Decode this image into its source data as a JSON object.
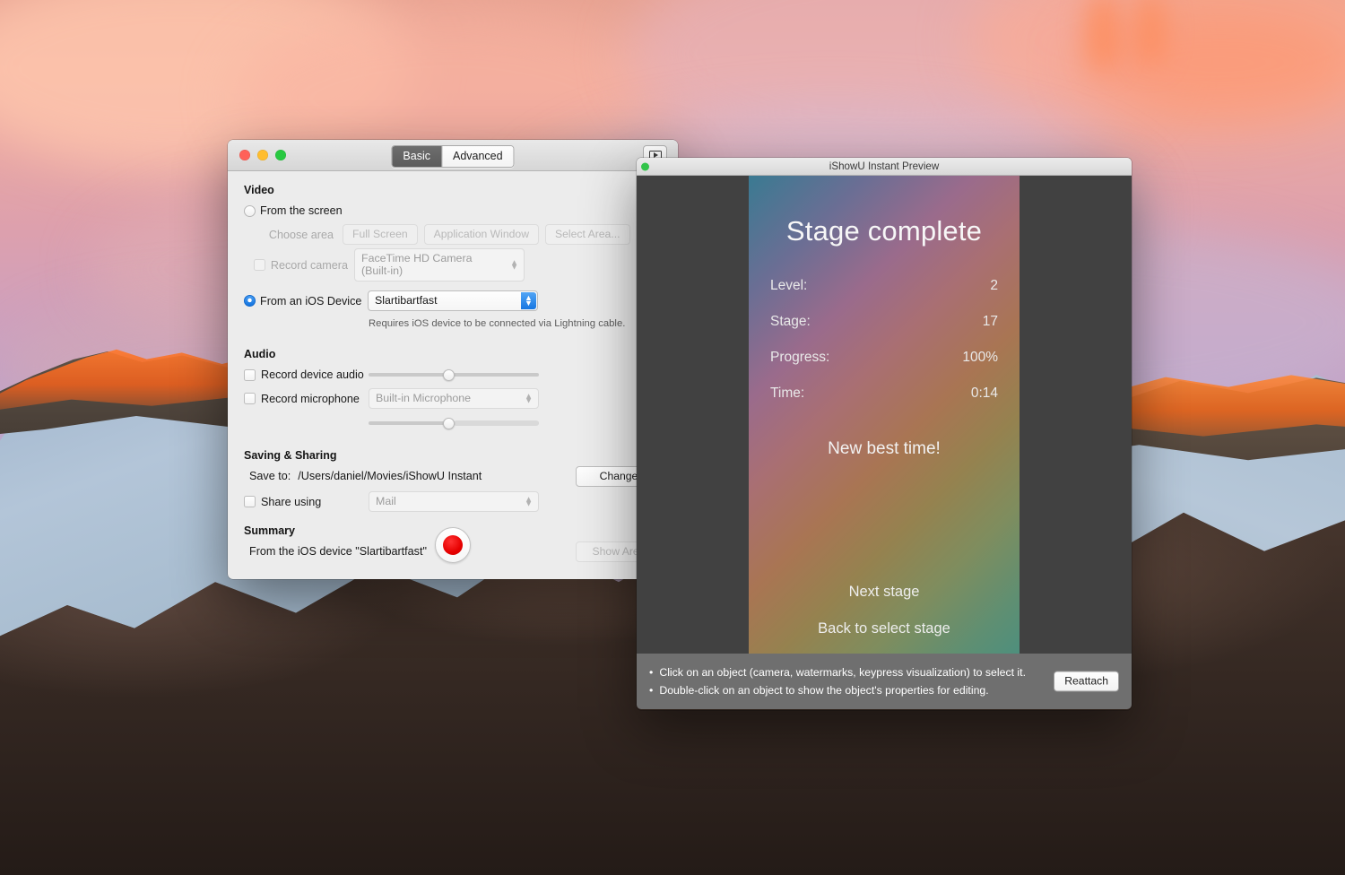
{
  "settings_window": {
    "traffic_lights": {
      "close": "close-button",
      "minimize": "minimize-button",
      "zoom": "zoom-button"
    },
    "tabs": [
      {
        "label": "Basic",
        "active": true
      },
      {
        "label": "Advanced",
        "active": false
      }
    ],
    "preview_toggle_icon": "preview-play-icon",
    "video": {
      "heading": "Video",
      "from_screen_label": "From the screen",
      "from_screen_selected": false,
      "choose_area_label": "Choose area",
      "area_buttons": [
        "Full Screen",
        "Application Window",
        "Select Area..."
      ],
      "record_camera_label": "Record camera",
      "record_camera_checked": false,
      "camera_value": "FaceTime HD Camera (Built-in)",
      "from_ios_label": "From an iOS Device",
      "from_ios_selected": true,
      "ios_device_value": "Slartibartfast",
      "ios_note": "Requires iOS device to be connected via Lightning cable."
    },
    "audio": {
      "heading": "Audio",
      "device_audio_label": "Record device audio",
      "device_audio_checked": false,
      "microphone_label": "Record microphone",
      "microphone_checked": false,
      "microphone_value": "Built-in Microphone"
    },
    "saving": {
      "heading": "Saving & Sharing",
      "save_to_label": "Save to:",
      "save_to_path": "/Users/daniel/Movies/iShowU Instant",
      "change_label": "Change",
      "share_using_label": "Share using",
      "share_using_checked": false,
      "share_value": "Mail"
    },
    "summary": {
      "heading": "Summary",
      "text": "From the iOS device \"Slartibartfast\"",
      "show_area_label": "Show Area"
    },
    "record_button_name": "record-button"
  },
  "preview_window": {
    "title": "iShowU Instant Preview",
    "status_dot_color": "#32c44a",
    "game": {
      "title": "Stage complete",
      "stats": [
        {
          "label": "Level:",
          "value": "2"
        },
        {
          "label": "Stage:",
          "value": "17"
        },
        {
          "label": "Progress:",
          "value": "100%"
        },
        {
          "label": "Time:",
          "value": "0:14"
        }
      ],
      "best_time_text": "New best time!",
      "menu": [
        "Next stage",
        "Back to select stage"
      ]
    },
    "hints": [
      "Click on an object (camera, watermarks, keypress visualization) to select it.",
      "Double-click on an object to show the object's properties for editing."
    ],
    "reattach_label": "Reattach"
  }
}
